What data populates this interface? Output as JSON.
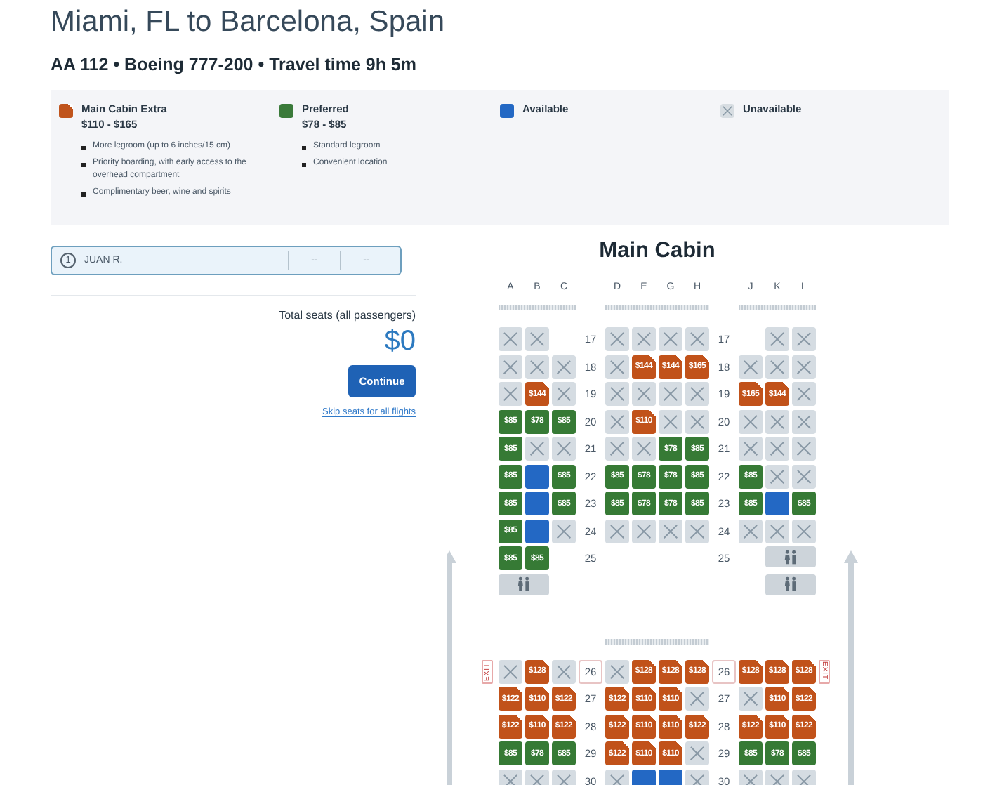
{
  "header": {
    "title": "Miami, FL to Barcelona, Spain",
    "subtitle": "AA 112 • Boeing 777-200 • Travel time 9h 5m"
  },
  "legend": [
    {
      "kind": "extra",
      "name": "Main Cabin Extra",
      "price": "$110 - $165",
      "features": [
        "More legroom (up to 6 inches/15 cm)",
        "Priority boarding, with early access to the overhead compartment",
        "Complimentary beer, wine and spirits"
      ]
    },
    {
      "kind": "preferred",
      "name": "Preferred",
      "price": "$78 - $85",
      "features": [
        "Standard legroom",
        "Convenient location"
      ]
    },
    {
      "kind": "available",
      "name": "Available"
    },
    {
      "kind": "unavailable",
      "name": "Unavailable"
    }
  ],
  "passengers": [
    {
      "number": "1",
      "name": "JUAN R.",
      "column_2": "--",
      "column_3": "--",
      "selected": true
    }
  ],
  "summary": {
    "label": "Total seats (all passengers)",
    "total": "$0"
  },
  "continue_button": "Continue",
  "skip_link": "Skip seats for all flights",
  "seat_map": {
    "cabin": "Main Cabin",
    "columns": [
      [
        "A",
        "B",
        "C"
      ],
      [
        "D",
        "E",
        "G",
        "H"
      ],
      [
        "J",
        "K",
        "L"
      ]
    ],
    "sections": [
      {
        "rows": [
          {
            "numbers": [
              "17",
              "17"
            ],
            "blocks": [
              [
                {
                  "kind": "unavailable"
                },
                {
                  "kind": "unavailable"
                },
                {
                  "kind": "empty"
                }
              ],
              [
                {
                  "kind": "unavailable"
                },
                {
                  "kind": "unavailable"
                },
                {
                  "kind": "unavailable"
                },
                {
                  "kind": "unavailable"
                }
              ],
              [
                {
                  "kind": "empty"
                },
                {
                  "kind": "unavailable"
                },
                {
                  "kind": "unavailable"
                }
              ]
            ]
          },
          {
            "numbers": [
              "18",
              "18"
            ],
            "blocks": [
              [
                {
                  "kind": "unavailable"
                },
                {
                  "kind": "unavailable"
                },
                {
                  "kind": "unavailable"
                }
              ],
              [
                {
                  "kind": "unavailable"
                },
                {
                  "kind": "extra",
                  "price": "$144"
                },
                {
                  "kind": "extra",
                  "price": "$144"
                },
                {
                  "kind": "extra",
                  "price": "$165"
                }
              ],
              [
                {
                  "kind": "unavailable"
                },
                {
                  "kind": "unavailable"
                },
                {
                  "kind": "unavailable"
                }
              ]
            ]
          },
          {
            "numbers": [
              "19",
              "19"
            ],
            "blocks": [
              [
                {
                  "kind": "unavailable"
                },
                {
                  "kind": "extra",
                  "price": "$144"
                },
                {
                  "kind": "unavailable"
                }
              ],
              [
                {
                  "kind": "unavailable"
                },
                {
                  "kind": "unavailable"
                },
                {
                  "kind": "unavailable"
                },
                {
                  "kind": "unavailable"
                }
              ],
              [
                {
                  "kind": "extra",
                  "price": "$165"
                },
                {
                  "kind": "extra",
                  "price": "$144"
                },
                {
                  "kind": "unavailable"
                }
              ]
            ]
          },
          {
            "numbers": [
              "20",
              "20"
            ],
            "blocks": [
              [
                {
                  "kind": "preferred",
                  "price": "$85"
                },
                {
                  "kind": "preferred",
                  "price": "$78"
                },
                {
                  "kind": "preferred",
                  "price": "$85"
                }
              ],
              [
                {
                  "kind": "unavailable"
                },
                {
                  "kind": "extra",
                  "price": "$110"
                },
                {
                  "kind": "unavailable"
                },
                {
                  "kind": "unavailable"
                }
              ],
              [
                {
                  "kind": "unavailable"
                },
                {
                  "kind": "unavailable"
                },
                {
                  "kind": "unavailable"
                }
              ]
            ]
          },
          {
            "numbers": [
              "21",
              "21"
            ],
            "blocks": [
              [
                {
                  "kind": "preferred",
                  "price": "$85"
                },
                {
                  "kind": "unavailable"
                },
                {
                  "kind": "unavailable"
                }
              ],
              [
                {
                  "kind": "unavailable"
                },
                {
                  "kind": "unavailable"
                },
                {
                  "kind": "preferred",
                  "price": "$78"
                },
                {
                  "kind": "preferred",
                  "price": "$85"
                }
              ],
              [
                {
                  "kind": "unavailable"
                },
                {
                  "kind": "unavailable"
                },
                {
                  "kind": "unavailable"
                }
              ]
            ]
          },
          {
            "numbers": [
              "22",
              "22"
            ],
            "blocks": [
              [
                {
                  "kind": "preferred",
                  "price": "$85"
                },
                {
                  "kind": "available"
                },
                {
                  "kind": "preferred",
                  "price": "$85"
                }
              ],
              [
                {
                  "kind": "preferred",
                  "price": "$85"
                },
                {
                  "kind": "preferred",
                  "price": "$78"
                },
                {
                  "kind": "preferred",
                  "price": "$78"
                },
                {
                  "kind": "preferred",
                  "price": "$85"
                }
              ],
              [
                {
                  "kind": "preferred",
                  "price": "$85"
                },
                {
                  "kind": "unavailable"
                },
                {
                  "kind": "unavailable"
                }
              ]
            ]
          },
          {
            "numbers": [
              "23",
              "23"
            ],
            "blocks": [
              [
                {
                  "kind": "preferred",
                  "price": "$85"
                },
                {
                  "kind": "available"
                },
                {
                  "kind": "preferred",
                  "price": "$85"
                }
              ],
              [
                {
                  "kind": "preferred",
                  "price": "$85"
                },
                {
                  "kind": "preferred",
                  "price": "$78"
                },
                {
                  "kind": "preferred",
                  "price": "$78"
                },
                {
                  "kind": "preferred",
                  "price": "$85"
                }
              ],
              [
                {
                  "kind": "preferred",
                  "price": "$85"
                },
                {
                  "kind": "available"
                },
                {
                  "kind": "preferred",
                  "price": "$85"
                }
              ]
            ]
          },
          {
            "numbers": [
              "24",
              "24"
            ],
            "blocks": [
              [
                {
                  "kind": "preferred",
                  "price": "$85"
                },
                {
                  "kind": "available"
                },
                {
                  "kind": "unavailable"
                }
              ],
              [
                {
                  "kind": "unavailable"
                },
                {
                  "kind": "unavailable"
                },
                {
                  "kind": "unavailable"
                },
                {
                  "kind": "unavailable"
                }
              ],
              [
                {
                  "kind": "unavailable"
                },
                {
                  "kind": "unavailable"
                },
                {
                  "kind": "unavailable"
                }
              ]
            ]
          },
          {
            "numbers": [
              "25",
              "25"
            ],
            "blocks": [
              [
                {
                  "kind": "preferred",
                  "price": "$85"
                },
                {
                  "kind": "preferred",
                  "price": "$85"
                },
                {
                  "kind": "empty"
                }
              ],
              [
                {
                  "kind": "empty"
                },
                {
                  "kind": "empty"
                },
                {
                  "kind": "empty"
                },
                {
                  "kind": "empty"
                }
              ],
              [
                {
                  "kind": "empty"
                },
                {
                  "kind": "lavatory"
                }
              ]
            ]
          },
          {
            "blocks": [
              [
                {
                  "kind": "lavatory"
                },
                {
                  "kind": "empty"
                }
              ],
              [
                {
                  "kind": "empty"
                },
                {
                  "kind": "empty"
                },
                {
                  "kind": "empty"
                },
                {
                  "kind": "empty"
                }
              ],
              [
                {
                  "kind": "empty"
                },
                {
                  "kind": "lavatory"
                }
              ]
            ]
          }
        ]
      },
      {
        "rows": [
          {
            "numbers": [
              "26",
              "26"
            ],
            "exit_signs": [
              "EXIT",
              "EXIT"
            ],
            "blocks": [
              [
                {
                  "kind": "unavailable"
                },
                {
                  "kind": "extra",
                  "price": "$128"
                },
                {
                  "kind": "unavailable"
                }
              ],
              [
                {
                  "kind": "unavailable"
                },
                {
                  "kind": "extra",
                  "price": "$128"
                },
                {
                  "kind": "extra",
                  "price": "$128"
                },
                {
                  "kind": "extra",
                  "price": "$128"
                }
              ],
              [
                {
                  "kind": "extra",
                  "price": "$128"
                },
                {
                  "kind": "extra",
                  "price": "$128"
                },
                {
                  "kind": "extra",
                  "price": "$128"
                }
              ]
            ]
          },
          {
            "numbers": [
              "27",
              "27"
            ],
            "blocks": [
              [
                {
                  "kind": "extra",
                  "price": "$122"
                },
                {
                  "kind": "extra",
                  "price": "$110"
                },
                {
                  "kind": "extra",
                  "price": "$122"
                }
              ],
              [
                {
                  "kind": "extra",
                  "price": "$122"
                },
                {
                  "kind": "extra",
                  "price": "$110"
                },
                {
                  "kind": "extra",
                  "price": "$110"
                },
                {
                  "kind": "unavailable"
                }
              ],
              [
                {
                  "kind": "unavailable"
                },
                {
                  "kind": "extra",
                  "price": "$110"
                },
                {
                  "kind": "extra",
                  "price": "$122"
                }
              ]
            ]
          },
          {
            "numbers": [
              "28",
              "28"
            ],
            "blocks": [
              [
                {
                  "kind": "extra",
                  "price": "$122"
                },
                {
                  "kind": "extra",
                  "price": "$110"
                },
                {
                  "kind": "extra",
                  "price": "$122"
                }
              ],
              [
                {
                  "kind": "extra",
                  "price": "$122"
                },
                {
                  "kind": "extra",
                  "price": "$110"
                },
                {
                  "kind": "extra",
                  "price": "$110"
                },
                {
                  "kind": "extra",
                  "price": "$122"
                }
              ],
              [
                {
                  "kind": "extra",
                  "price": "$122"
                },
                {
                  "kind": "extra",
                  "price": "$110"
                },
                {
                  "kind": "extra",
                  "price": "$122"
                }
              ]
            ]
          },
          {
            "numbers": [
              "29",
              "29"
            ],
            "blocks": [
              [
                {
                  "kind": "preferred",
                  "price": "$85"
                },
                {
                  "kind": "preferred",
                  "price": "$78"
                },
                {
                  "kind": "preferred",
                  "price": "$85"
                }
              ],
              [
                {
                  "kind": "extra",
                  "price": "$122"
                },
                {
                  "kind": "extra",
                  "price": "$110"
                },
                {
                  "kind": "extra",
                  "price": "$110"
                },
                {
                  "kind": "unavailable"
                }
              ],
              [
                {
                  "kind": "preferred",
                  "price": "$85"
                },
                {
                  "kind": "preferred",
                  "price": "$78"
                },
                {
                  "kind": "preferred",
                  "price": "$85"
                }
              ]
            ]
          },
          {
            "numbers": [
              "30",
              "30"
            ],
            "blocks": [
              [
                {
                  "kind": "unavailable"
                },
                {
                  "kind": "unavailable"
                },
                {
                  "kind": "unavailable"
                }
              ],
              [
                {
                  "kind": "unavailable"
                },
                {
                  "kind": "available"
                },
                {
                  "kind": "available"
                },
                {
                  "kind": "unavailable"
                }
              ],
              [
                {
                  "kind": "unavailable"
                },
                {
                  "kind": "unavailable"
                },
                {
                  "kind": "unavailable"
                }
              ]
            ]
          }
        ]
      }
    ]
  }
}
